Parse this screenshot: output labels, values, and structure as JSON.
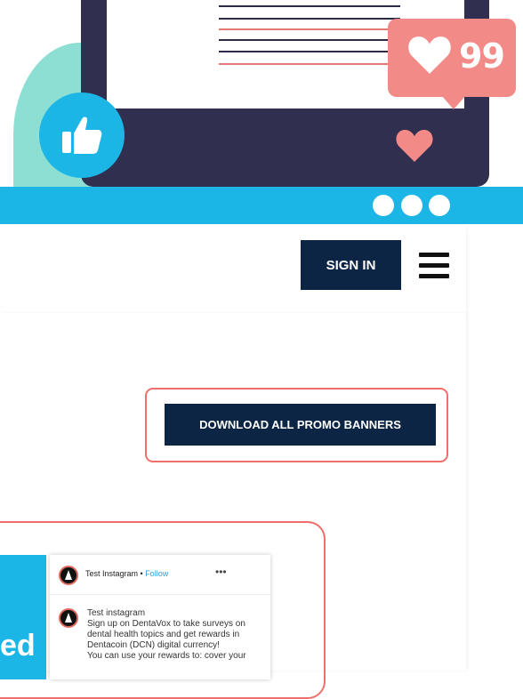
{
  "hero": {
    "like_count": "99",
    "colors": {
      "blue": "#1bb5e6",
      "navy": "#312f4f",
      "coral": "#f28b87",
      "teal": "#8ddfd3"
    }
  },
  "header": {
    "sign_in_label": "SIGN IN",
    "menu_icon": "hamburger-menu-icon"
  },
  "main": {
    "download_label": "DOWNLOAD ALL PROMO BANNERS",
    "promo_partial_word": "ed",
    "instagram": {
      "username": "Test Instagram",
      "separator": " • ",
      "follow_label": "Follow",
      "more_label": "•••",
      "caption_user": "Test instagram",
      "caption_lines": [
        "Sign up on DentaVox to take surveys on",
        "dental health topics and get rewards in",
        "Dentacoin (DCN) digital currency!",
        "You can use your rewards to: cover your"
      ]
    }
  }
}
